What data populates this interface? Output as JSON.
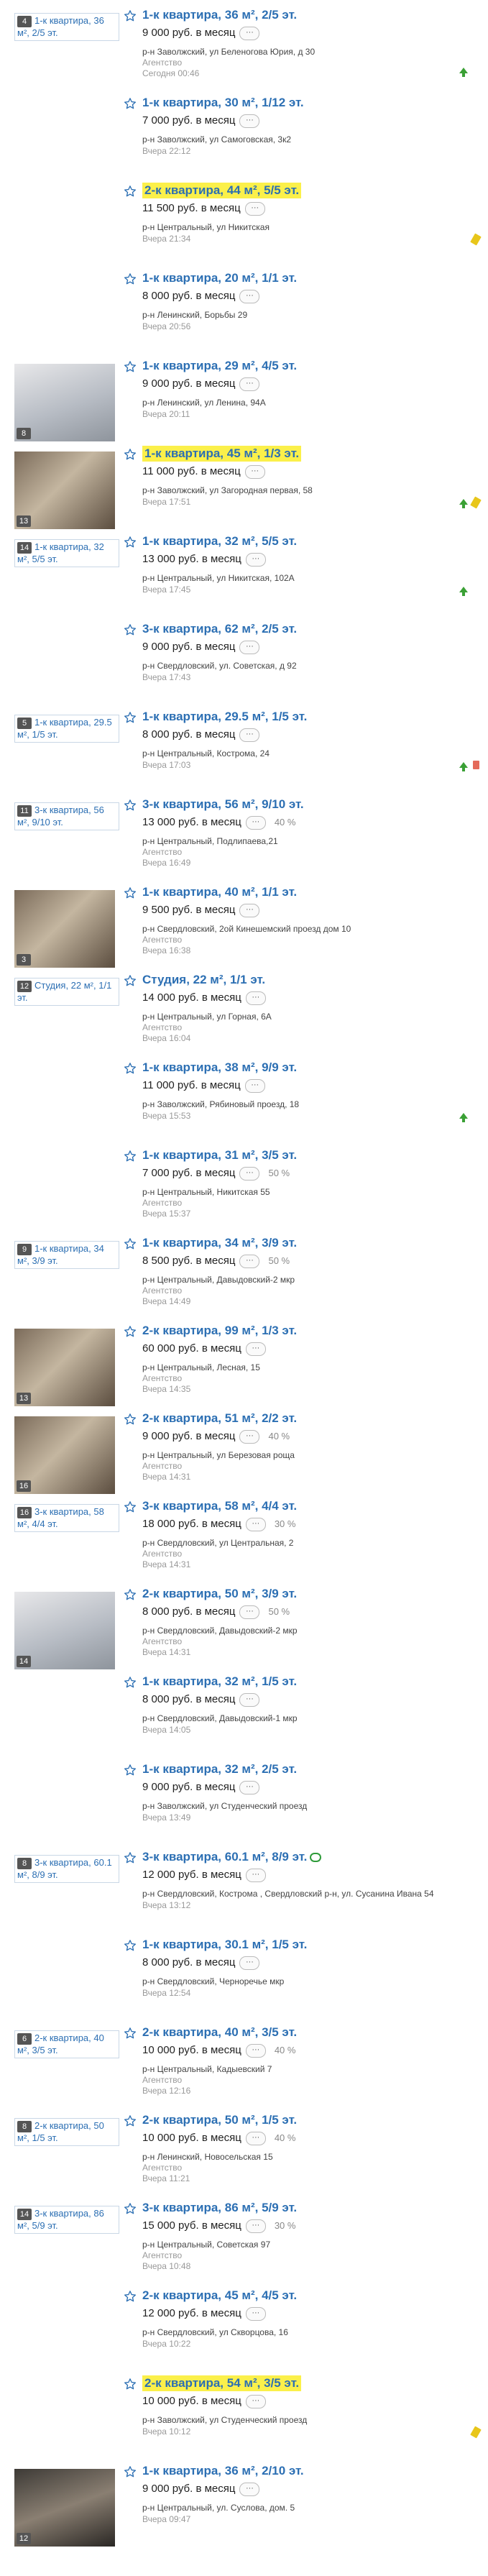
{
  "listings": [
    {
      "thumb": "broken",
      "thumb_text": "1-к квартира, 36 м², 2/5 эт.",
      "photos": "4",
      "title": "1-к квартира, 36 м², 2/5 эт.",
      "highlight": false,
      "price": "9 000 руб. в месяц",
      "discount": "",
      "address": "р-н Заволжский, ул Беленогова Юрия, д 30",
      "agency": "Агентство",
      "time": "Сегодня 00:46",
      "icon_up": true,
      "icon_pen": false,
      "icon_trash": false,
      "promo": false
    },
    {
      "thumb": "none",
      "thumb_text": "",
      "photos": "",
      "title": "1-к квартира, 30 м², 1/12 эт.",
      "highlight": false,
      "price": "7 000 руб. в месяц",
      "discount": "",
      "address": "р-н Заволжский, ул Самоговская, 3к2",
      "agency": "",
      "time": "Вчера 22:12",
      "icon_up": false,
      "icon_pen": false,
      "icon_trash": false,
      "promo": false
    },
    {
      "thumb": "none",
      "thumb_text": "",
      "photos": "",
      "title": "2-к квартира, 44 м², 5/5 эт.",
      "highlight": true,
      "price": "11 500 руб. в месяц",
      "discount": "",
      "address": "р-н Центральный, ул Никитская",
      "agency": "",
      "time": "Вчера 21:34",
      "icon_up": false,
      "icon_pen": true,
      "icon_trash": false,
      "promo": false
    },
    {
      "thumb": "none",
      "thumb_text": "",
      "photos": "",
      "title": "1-к квартира, 20 м², 1/1 эт.",
      "highlight": false,
      "price": "8 000 руб. в месяц",
      "discount": "",
      "address": "р-н Ленинский, Борьбы 29",
      "agency": "",
      "time": "Вчера 20:56",
      "icon_up": false,
      "icon_pen": false,
      "icon_trash": false,
      "promo": false
    },
    {
      "thumb": "photo-light",
      "thumb_text": "",
      "photos": "8",
      "title": "1-к квартира, 29 м², 4/5 эт.",
      "highlight": false,
      "price": "9 000 руб. в месяц",
      "discount": "",
      "address": "р-н Ленинский, ул Ленина, 94А",
      "agency": "",
      "time": "Вчера 20:11",
      "icon_up": false,
      "icon_pen": false,
      "icon_trash": false,
      "promo": false
    },
    {
      "thumb": "photo",
      "thumb_text": "",
      "photos": "13",
      "title": "1-к квартира, 45 м², 1/3 эт.",
      "highlight": true,
      "price": "11 000 руб. в месяц",
      "discount": "",
      "address": "р-н Заволжский, ул Загородная первая, 58",
      "agency": "",
      "time": "Вчера 17:51",
      "icon_up": true,
      "icon_pen": true,
      "icon_trash": false,
      "promo": false
    },
    {
      "thumb": "broken",
      "thumb_text": "1-к квартира, 32 м², 5/5 эт.",
      "photos": "14",
      "title": "1-к квартира, 32 м², 5/5 эт.",
      "highlight": false,
      "price": "13 000 руб. в месяц",
      "discount": "",
      "address": "р-н Центральный, ул Никитская, 102А",
      "agency": "",
      "time": "Вчера 17:45",
      "icon_up": true,
      "icon_pen": false,
      "icon_trash": false,
      "promo": false
    },
    {
      "thumb": "none",
      "thumb_text": "",
      "photos": "",
      "title": "3-к квартира, 62 м², 2/5 эт.",
      "highlight": false,
      "price": "9 000 руб. в месяц",
      "discount": "",
      "address": "р-н Свердловский, ул. Советская, д 92",
      "agency": "",
      "time": "Вчера 17:43",
      "icon_up": false,
      "icon_pen": false,
      "icon_trash": false,
      "promo": false
    },
    {
      "thumb": "broken",
      "thumb_text": "1-к квартира, 29.5 м², 1/5 эт.",
      "photos": "5",
      "title": "1-к квартира, 29.5 м², 1/5 эт.",
      "highlight": false,
      "price": "8 000 руб. в месяц",
      "discount": "",
      "address": "р-н Центральный, Кострома, 24",
      "agency": "",
      "time": "Вчера 17:03",
      "icon_up": true,
      "icon_pen": false,
      "icon_trash": true,
      "promo": false
    },
    {
      "thumb": "broken",
      "thumb_text": "3-к квартира, 56 м², 9/10 эт.",
      "photos": "11",
      "title": "3-к квартира, 56 м², 9/10 эт.",
      "highlight": false,
      "price": "13 000 руб. в месяц",
      "discount": "40 %",
      "address": "р-н Центральный, Подлипаева,21",
      "agency": "Агентство",
      "time": "Вчера 16:49",
      "icon_up": false,
      "icon_pen": false,
      "icon_trash": false,
      "promo": false
    },
    {
      "thumb": "photo",
      "thumb_text": "",
      "photos": "3",
      "title": "1-к квартира, 40 м², 1/1 эт.",
      "highlight": false,
      "price": "9 500 руб. в месяц",
      "discount": "",
      "address": "р-н Свердловский, 2ой Кинешемский проезд дом 10",
      "agency": "Агентство",
      "time": "Вчера 16:38",
      "icon_up": false,
      "icon_pen": false,
      "icon_trash": false,
      "promo": false
    },
    {
      "thumb": "broken",
      "thumb_text": "Студия, 22 м², 1/1 эт.",
      "photos": "12",
      "title": "Студия, 22 м², 1/1 эт.",
      "highlight": false,
      "price": "14 000 руб. в месяц",
      "discount": "",
      "address": "р-н Центральный, ул Горная, 6А",
      "agency": "Агентство",
      "time": "Вчера 16:04",
      "icon_up": false,
      "icon_pen": false,
      "icon_trash": false,
      "promo": false
    },
    {
      "thumb": "none",
      "thumb_text": "",
      "photos": "",
      "title": "1-к квартира, 38 м², 9/9 эт.",
      "highlight": false,
      "price": "11 000 руб. в месяц",
      "discount": "",
      "address": "р-н Заволжский, Рябиновый проезд, 18",
      "agency": "",
      "time": "Вчера 15:53",
      "icon_up": true,
      "icon_pen": false,
      "icon_trash": false,
      "promo": false
    },
    {
      "thumb": "none",
      "thumb_text": "",
      "photos": "",
      "title": "1-к квартира, 31 м², 3/5 эт.",
      "highlight": false,
      "price": "7 000 руб. в месяц",
      "discount": "50 %",
      "address": "р-н Центральный, Никитская 55",
      "agency": "Агентство",
      "time": "Вчера 15:37",
      "icon_up": false,
      "icon_pen": false,
      "icon_trash": false,
      "promo": false
    },
    {
      "thumb": "broken",
      "thumb_text": "1-к квартира, 34 м², 3/9 эт.",
      "photos": "9",
      "title": "1-к квартира, 34 м², 3/9 эт.",
      "highlight": false,
      "price": "8 500 руб. в месяц",
      "discount": "50 %",
      "address": "р-н Центральный, Давыдовский-2 мкр",
      "agency": "Агентство",
      "time": "Вчера 14:49",
      "icon_up": false,
      "icon_pen": false,
      "icon_trash": false,
      "promo": false
    },
    {
      "thumb": "photo",
      "thumb_text": "",
      "photos": "13",
      "title": "2-к квартира, 99 м², 1/3 эт.",
      "highlight": false,
      "price": "60 000 руб. в месяц",
      "discount": "",
      "address": "р-н Центральный, Лесная, 15",
      "agency": "Агентство",
      "time": "Вчера 14:35",
      "icon_up": false,
      "icon_pen": false,
      "icon_trash": false,
      "promo": false
    },
    {
      "thumb": "photo",
      "thumb_text": "",
      "photos": "16",
      "title": "2-к квартира, 51 м², 2/2 эт.",
      "highlight": false,
      "price": "9 000 руб. в месяц",
      "discount": "40 %",
      "address": "р-н Центральный, ул Березовая роща",
      "agency": "Агентство",
      "time": "Вчера 14:31",
      "icon_up": false,
      "icon_pen": false,
      "icon_trash": false,
      "promo": false
    },
    {
      "thumb": "broken",
      "thumb_text": "3-к квартира, 58 м², 4/4 эт.",
      "photos": "16",
      "title": "3-к квартира, 58 м², 4/4 эт.",
      "highlight": false,
      "price": "18 000 руб. в месяц",
      "discount": "30 %",
      "address": "р-н Свердловский, ул Центральная, 2",
      "agency": "Агентство",
      "time": "Вчера 14:31",
      "icon_up": false,
      "icon_pen": false,
      "icon_trash": false,
      "promo": false
    },
    {
      "thumb": "photo-light",
      "thumb_text": "",
      "photos": "14",
      "title": "2-к квартира, 50 м², 3/9 эт.",
      "highlight": false,
      "price": "8 000 руб. в месяц",
      "discount": "50 %",
      "address": "р-н Свердловский, Давыдовский-2 мкр",
      "agency": "Агентство",
      "time": "Вчера 14:31",
      "icon_up": false,
      "icon_pen": false,
      "icon_trash": false,
      "promo": false
    },
    {
      "thumb": "none",
      "thumb_text": "",
      "photos": "",
      "title": "1-к квартира, 32 м², 1/5 эт.",
      "highlight": false,
      "price": "8 000 руб. в месяц",
      "discount": "",
      "address": "р-н Свердловский, Давыдовский-1 мкр",
      "agency": "",
      "time": "Вчера 14:05",
      "icon_up": false,
      "icon_pen": false,
      "icon_trash": false,
      "promo": false
    },
    {
      "thumb": "none",
      "thumb_text": "",
      "photos": "",
      "title": "1-к квартира, 32 м², 2/5 эт.",
      "highlight": false,
      "price": "9 000 руб. в месяц",
      "discount": "",
      "address": "р-н Заволжский, ул Студенческий проезд",
      "agency": "",
      "time": "Вчера 13:49",
      "icon_up": false,
      "icon_pen": false,
      "icon_trash": false,
      "promo": false
    },
    {
      "thumb": "broken",
      "thumb_text": "3-к квартира, 60.1 м², 8/9 эт.",
      "photos": "8",
      "title": "3-к квартира, 60.1 м², 8/9 эт.",
      "highlight": false,
      "price": "12 000 руб. в месяц",
      "discount": "",
      "address": "р-н Свердловский, Кострома , Свердловский р-н, ул. Сусанина Ивана 54",
      "agency": "",
      "time": "Вчера 13:12",
      "icon_up": false,
      "icon_pen": false,
      "icon_trash": false,
      "promo": true
    },
    {
      "thumb": "none",
      "thumb_text": "",
      "photos": "",
      "title": "1-к квартира, 30.1 м², 1/5 эт.",
      "highlight": false,
      "price": "8 000 руб. в месяц",
      "discount": "",
      "address": "р-н Свердловский, Черноречье мкр",
      "agency": "",
      "time": "Вчера 12:54",
      "icon_up": false,
      "icon_pen": false,
      "icon_trash": false,
      "promo": false
    },
    {
      "thumb": "broken",
      "thumb_text": "2-к квартира, 40 м², 3/5 эт.",
      "photos": "6",
      "title": "2-к квартира, 40 м², 3/5 эт.",
      "highlight": false,
      "price": "10 000 руб. в месяц",
      "discount": "40 %",
      "address": "р-н Центральный, Кадыевский 7",
      "agency": "Агентство",
      "time": "Вчера 12:16",
      "icon_up": false,
      "icon_pen": false,
      "icon_trash": false,
      "promo": false
    },
    {
      "thumb": "broken",
      "thumb_text": "2-к квартира, 50 м², 1/5 эт.",
      "photos": "8",
      "title": "2-к квартира, 50 м², 1/5 эт.",
      "highlight": false,
      "price": "10 000 руб. в месяц",
      "discount": "40 %",
      "address": "р-н Ленинский, Новосельская 15",
      "agency": "Агентство",
      "time": "Вчера 11:21",
      "icon_up": false,
      "icon_pen": false,
      "icon_trash": false,
      "promo": false
    },
    {
      "thumb": "broken",
      "thumb_text": "3-к квартира, 86 м², 5/9 эт.",
      "photos": "14",
      "title": "3-к квартира, 86 м², 5/9 эт.",
      "highlight": false,
      "price": "15 000 руб. в месяц",
      "discount": "30 %",
      "address": "р-н Центральный, Советская 97",
      "agency": "Агентство",
      "time": "Вчера 10:48",
      "icon_up": false,
      "icon_pen": false,
      "icon_trash": false,
      "promo": false
    },
    {
      "thumb": "none",
      "thumb_text": "",
      "photos": "",
      "title": "2-к квартира, 45 м², 4/5 эт.",
      "highlight": false,
      "price": "12 000 руб. в месяц",
      "discount": "",
      "address": "р-н Свердловский, ул Скворцова, 16",
      "agency": "",
      "time": "Вчера 10:22",
      "icon_up": false,
      "icon_pen": false,
      "icon_trash": false,
      "promo": false
    },
    {
      "thumb": "none",
      "thumb_text": "",
      "photos": "",
      "title": "2-к квартира, 54 м², 3/5 эт.",
      "highlight": true,
      "price": "10 000 руб. в месяц",
      "discount": "",
      "address": "р-н Заволжский, ул Студенческий проезд",
      "agency": "",
      "time": "Вчера 10:12",
      "icon_up": false,
      "icon_pen": true,
      "icon_trash": false,
      "promo": false
    },
    {
      "thumb": "photo-dark",
      "thumb_text": "",
      "photos": "12",
      "title": "1-к квартира, 36 м², 2/10 эт.",
      "highlight": false,
      "price": "9 000 руб. в месяц",
      "discount": "",
      "address": "р-н Центральный, ул. Суслова, дом. 5",
      "agency": "",
      "time": "Вчера 09:47",
      "icon_up": false,
      "icon_pen": false,
      "icon_trash": false,
      "promo": false
    }
  ],
  "more_button": "···",
  "colors": {
    "link": "#2c6fb3",
    "highlight": "#fbf04a",
    "up": "#3aa035",
    "pen": "#e8c61a",
    "trash": "#e46a5a"
  }
}
